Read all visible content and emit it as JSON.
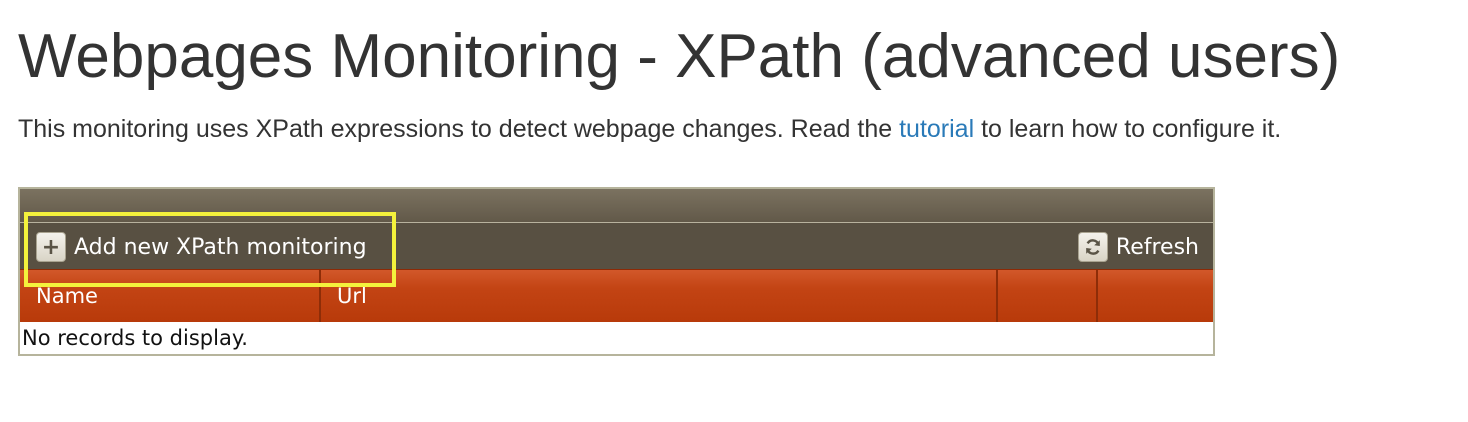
{
  "page": {
    "title": "Webpages Monitoring - XPath (advanced users)",
    "description": {
      "before_link": "This monitoring uses XPath expressions to detect webpage changes. Read the ",
      "link_text": "tutorial",
      "after_link": " to learn how to configure it."
    }
  },
  "grid": {
    "toolbar": {
      "add_label": "Add new XPath monitoring",
      "add_icon": "plus-icon",
      "refresh_label": "Refresh",
      "refresh_icon": "refresh-icon"
    },
    "columns": [
      "Name",
      "Url",
      "",
      ""
    ],
    "empty_message": "No records to display."
  },
  "colors": {
    "toolbar_bg": "#585042",
    "header_bg": "#c34414",
    "link": "#2a7ab8",
    "highlight": "#f4f23c"
  }
}
